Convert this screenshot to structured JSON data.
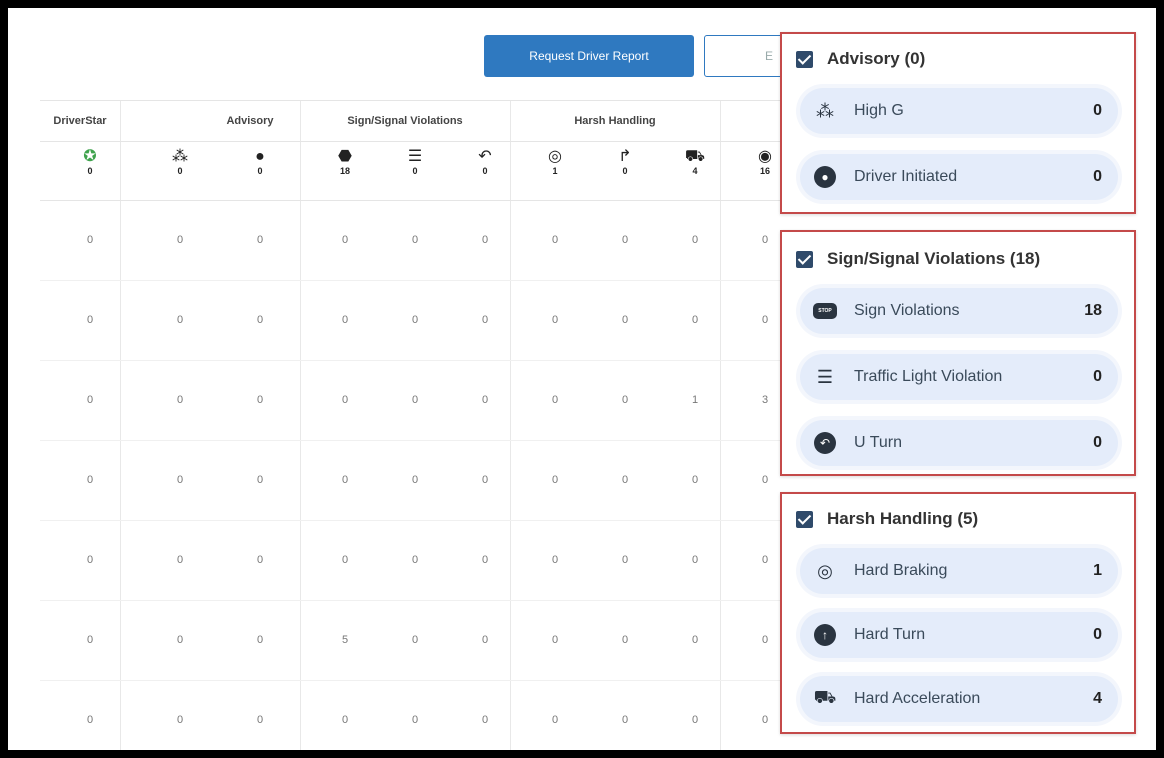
{
  "toolbar": {
    "request_label": "Request Driver Report",
    "secondary_label": "E"
  },
  "table": {
    "groups": [
      "DriverStar",
      "Advisory",
      "Sign/Signal Violations",
      "Harsh Handling"
    ],
    "icon_counts": [
      "0",
      "0",
      "0",
      "18",
      "0",
      "0",
      "1",
      "0",
      "4",
      "16"
    ],
    "rows": [
      [
        "0",
        "0",
        "0",
        "0",
        "0",
        "0",
        "0",
        "0",
        "0",
        "0"
      ],
      [
        "0",
        "0",
        "0",
        "0",
        "0",
        "0",
        "0",
        "0",
        "0",
        "0"
      ],
      [
        "0",
        "0",
        "0",
        "0",
        "0",
        "0",
        "0",
        "0",
        "1",
        "3"
      ],
      [
        "0",
        "0",
        "0",
        "0",
        "0",
        "0",
        "0",
        "0",
        "0",
        "0"
      ],
      [
        "0",
        "0",
        "0",
        "0",
        "0",
        "0",
        "0",
        "0",
        "0",
        "0"
      ],
      [
        "0",
        "0",
        "0",
        "5",
        "0",
        "0",
        "0",
        "0",
        "0",
        "0"
      ],
      [
        "0",
        "0",
        "0",
        "0",
        "0",
        "0",
        "0",
        "0",
        "0",
        "0"
      ]
    ]
  },
  "advisory": {
    "title": "Advisory (0)",
    "items": [
      {
        "label": "High G",
        "value": "0",
        "icon": "high-g-icon"
      },
      {
        "label": "Driver Initiated",
        "value": "0",
        "icon": "driver-initiated-icon"
      }
    ]
  },
  "sign_signal": {
    "title": "Sign/Signal Violations (18)",
    "items": [
      {
        "label": "Sign Violations",
        "value": "18",
        "icon": "stop-sign-icon",
        "badge": "STOP"
      },
      {
        "label": "Traffic Light Violation",
        "value": "0",
        "icon": "traffic-light-icon"
      },
      {
        "label": "U Turn",
        "value": "0",
        "icon": "u-turn-icon"
      }
    ]
  },
  "harsh": {
    "title": "Harsh Handling (5)",
    "items": [
      {
        "label": "Hard Braking",
        "value": "1",
        "icon": "hard-braking-icon"
      },
      {
        "label": "Hard Turn",
        "value": "0",
        "icon": "hard-turn-icon"
      },
      {
        "label": "Hard Acceleration",
        "value": "4",
        "icon": "hard-acceleration-icon"
      }
    ]
  },
  "colors": {
    "accent": "#2f79c0",
    "panel_border": "#c44a4a",
    "pill_bg": "#e4ecfa",
    "driverstar": "#3fa34d"
  }
}
